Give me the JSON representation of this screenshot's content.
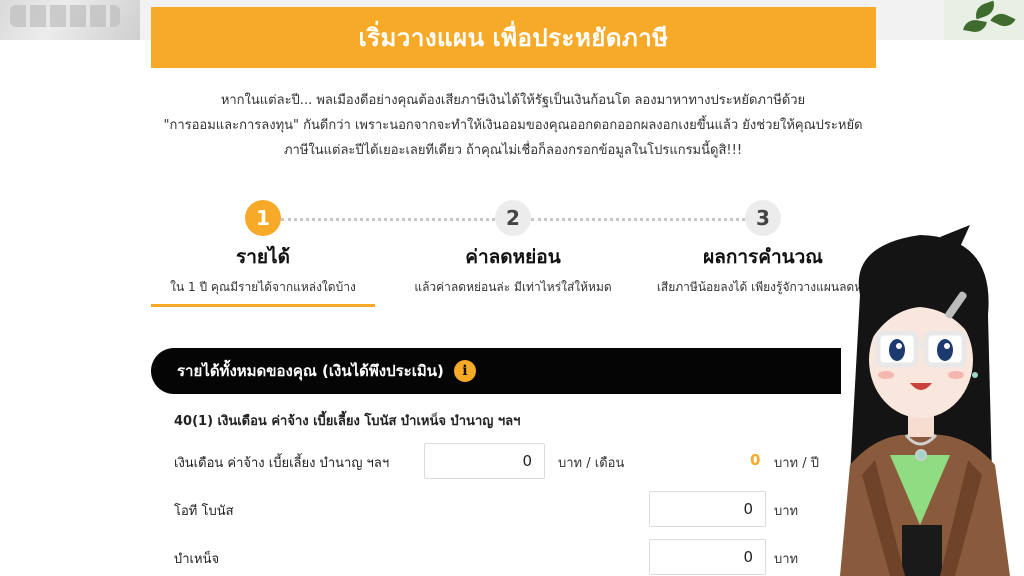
{
  "banner": {
    "title_main": "เริ่มวางแผน",
    "title_accent": "เพื่อประหยัดภาษี"
  },
  "intro": {
    "line1": "หากในแต่ละปี... พลเมืองดีอย่างคุณต้องเสียภาษีเงินได้ให้รัฐเป็นเงินก้อนโต ลองมาหาทางประหยัดภาษีด้วย",
    "line2": "\"การออมและการลงทุน\" กันดีกว่า เพราะนอกจากจะทำให้เงินออมของคุณออกดอกออกผลงอกเงยขึ้นแล้ว ยังช่วยให้คุณประหยัด",
    "line3": "ภาษีในแต่ละปีได้เยอะเลยทีเดียว ถ้าคุณไม่เชื่อก็ลองกรอกข้อมูลในโปรแกรมนี้ดูสิ!!!"
  },
  "steps": [
    {
      "number": "1",
      "title": "รายได้",
      "desc": "ใน 1 ปี คุณมีรายได้จากแหล่งใดบ้าง",
      "active": true
    },
    {
      "number": "2",
      "title": "ค่าลดหย่อน",
      "desc": "แล้วค่าลดหย่อนล่ะ มีเท่าไหร่ใส่ให้หมด",
      "active": false
    },
    {
      "number": "3",
      "title": "ผลการคำนวณ",
      "desc": "เสียภาษีน้อยลงได้ เพียงรู้จักวางแผนลดหย่",
      "active": false
    }
  ],
  "section": {
    "title": "รายได้ทั้งหมดของคุณ (เงินได้พึงประเมิน)",
    "info_icon": "info-icon"
  },
  "form": {
    "subsection_title": "40(1) เงินเดือน ค่าจ้าง เบี้ยเลี้ยง โบนัส บำเหน็จ บำนาญ ฯลฯ",
    "salary": {
      "label": "เงินเดือน ค่าจ้าง เบี้ยเลี้ยง บำนาญ ฯลฯ",
      "value": "0",
      "unit_month": "บาท / เดือน",
      "yearly_value": "0",
      "unit_year": "บาท / ปี"
    },
    "bonus": {
      "label": "โอที โบนัส",
      "value": "0",
      "unit": "บาท"
    },
    "pension": {
      "label": "บำเหน็จ",
      "value": "0",
      "unit": "บาท"
    }
  },
  "colors": {
    "accent": "#f7a928",
    "header_bg": "#050505"
  }
}
